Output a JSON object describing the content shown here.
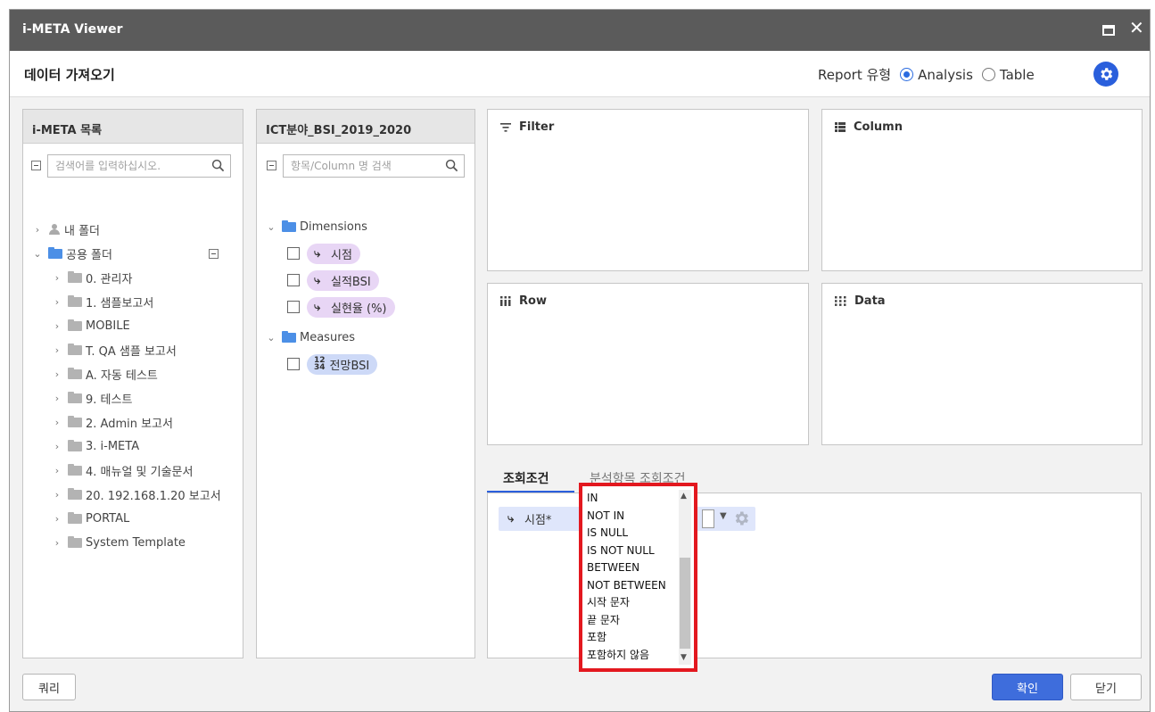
{
  "window": {
    "title": "i-META Viewer"
  },
  "header": {
    "title": "데이터 가져오기",
    "report_label": "Report 유형",
    "options": [
      {
        "label": "Analysis",
        "selected": true
      },
      {
        "label": "Table",
        "selected": false
      }
    ]
  },
  "left_panel": {
    "title": "i-META 목록",
    "search_placeholder": "검색어를 입력하십시오.",
    "tree": [
      {
        "label": "내 폴더",
        "icon": "user-icon",
        "expanded": false
      },
      {
        "label": "공용 폴더",
        "icon": "folder-icon-blue",
        "expanded": true
      },
      {
        "label": "0. 관리자"
      },
      {
        "label": "1. 샘플보고서"
      },
      {
        "label": "MOBILE"
      },
      {
        "label": "T. QA 샘플 보고서"
      },
      {
        "label": "A. 자동 테스트"
      },
      {
        "label": "9. 테스트"
      },
      {
        "label": "2. Admin 보고서"
      },
      {
        "label": "3. i-META"
      },
      {
        "label": "4. 매뉴얼 및 기술문서"
      },
      {
        "label": "20. 192.168.1.20 보고서"
      },
      {
        "label": "PORTAL"
      },
      {
        "label": "System Template"
      }
    ]
  },
  "mid_panel": {
    "title": "ICT분야_BSI_2019_2020",
    "search_placeholder": "항목/Column 명 검색",
    "dimensions_label": "Dimensions",
    "dimensions": [
      "시점",
      "실적BSI",
      "실현율 (%)"
    ],
    "measures_label": "Measures",
    "measures": [
      "전망BSI"
    ],
    "measure_icon_top": "12",
    "measure_icon_bottom": "34"
  },
  "zones": {
    "filter": "Filter",
    "column": "Column",
    "row": "Row",
    "data": "Data"
  },
  "tabs": {
    "active": "조회조건",
    "inactive": "분석항목 조회조건"
  },
  "condition": {
    "field_label": "시점*"
  },
  "dropdown": {
    "options": [
      "IN",
      "NOT IN",
      "IS NULL",
      "IS NOT NULL",
      "BETWEEN",
      "NOT BETWEEN",
      "시작 문자",
      "끝 문자",
      "포함",
      "포함하지 않음"
    ]
  },
  "footer": {
    "query_label": "쿼리",
    "ok_label": "확인",
    "close_label": "닫기"
  },
  "colors": {
    "accent": "#2a5fdc",
    "highlight_border": "#e3181f",
    "dimension_pill": "#e8d6f5",
    "measure_pill": "#cdd9f7"
  }
}
